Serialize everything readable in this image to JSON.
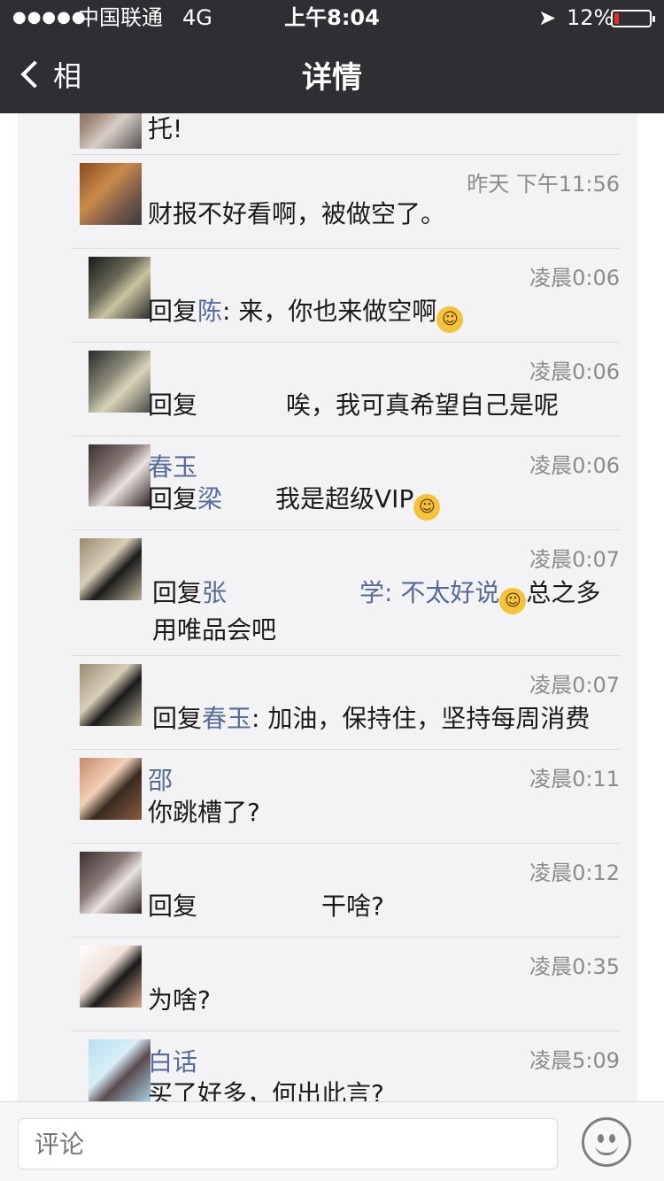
{
  "status_bar": {
    "signal": "●●●●●",
    "carrier": "中国联通",
    "network": "4G",
    "time": "上午8:04",
    "location_icon": "location-arrow-icon",
    "battery": "12%",
    "battery_level": 0.12
  },
  "nav": {
    "back_label": "相",
    "title": "详情"
  },
  "partial_top": {
    "text": "托!"
  },
  "comments": [
    {
      "name": "",
      "time": "昨天 下午11:56",
      "text": "财报不好看啊，被做空了。"
    },
    {
      "name": "",
      "time": "凌晨0:06",
      "reply_prefix": "回复",
      "reply_target": "陈",
      "text": ": 来，你也来做空啊"
    },
    {
      "name": "",
      "time": "凌晨0:06",
      "reply_prefix": "回复",
      "reply_target": "",
      "text": "唉，我可真希望自己是呢"
    },
    {
      "name": "春玉",
      "time": "凌晨0:06",
      "reply_prefix": "回复",
      "reply_target": "梁",
      "text": "我是超级VIP"
    },
    {
      "name": "",
      "time": "凌晨0:07",
      "reply_prefix": "回复",
      "reply_target": "张",
      "text": "学: 不太好说",
      "text2": "总之多",
      "text3": "用唯品会吧"
    },
    {
      "name": "",
      "time": "凌晨0:07",
      "reply_prefix": "回复",
      "reply_target": "春玉",
      "text": ": 加油，保持住，坚持每周消费"
    },
    {
      "name": "邵",
      "time": "凌晨0:11",
      "text": "你跳槽了?"
    },
    {
      "name": "",
      "time": "凌晨0:12",
      "reply_prefix": "回复",
      "reply_target": "",
      "text": "干啥?"
    },
    {
      "name": "",
      "time": "凌晨0:35",
      "text": "为啥?"
    },
    {
      "name": "白话",
      "time": "凌晨5:09",
      "text": "买了好多，何出此言?"
    }
  ],
  "bottom_bar": {
    "input_placeholder": "评论",
    "emoji_button_icon": "smiley-face-icon"
  }
}
